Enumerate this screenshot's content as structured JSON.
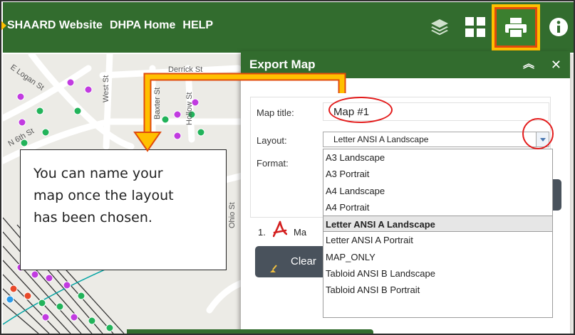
{
  "header": {
    "links": [
      "SHAARD Website",
      "DHPA Home",
      "HELP"
    ],
    "icons": [
      "layers-icon",
      "grid-icon",
      "print-icon",
      "info-icon"
    ],
    "bar_color": "#326c2e",
    "highlight_color": "#ffc000"
  },
  "map": {
    "streets": [
      "Derrick St",
      "E Logan St",
      "West St",
      "Baxter St",
      "Hollow St",
      "N 6th St",
      "Ohio St"
    ]
  },
  "panel": {
    "title": "Export Map",
    "map_title_label": "Map title:",
    "map_title_value": "Map #1",
    "layout_label": "Layout:",
    "layout_value": "Letter ANSI A Landscape",
    "format_label": "Format:",
    "result_index": "1.",
    "result_text_partial": "Ma",
    "clear_button": "Clear"
  },
  "layout_options": [
    {
      "label": "A3 Landscape",
      "selected": false
    },
    {
      "label": "A3 Portrait",
      "selected": false
    },
    {
      "label": "A4 Landscape",
      "selected": false
    },
    {
      "label": "A4 Portrait",
      "selected": false
    },
    {
      "label": "Letter ANSI A Landscape",
      "selected": true
    },
    {
      "label": "Letter ANSI A Portrait",
      "selected": false
    },
    {
      "label": "MAP_ONLY",
      "selected": false
    },
    {
      "label": "Tabloid ANSI B Landscape",
      "selected": false
    },
    {
      "label": "Tabloid ANSI B Portrait",
      "selected": false
    }
  ],
  "callout": {
    "lines": [
      "You can name your",
      "map once the layout",
      "has been chosen."
    ]
  }
}
